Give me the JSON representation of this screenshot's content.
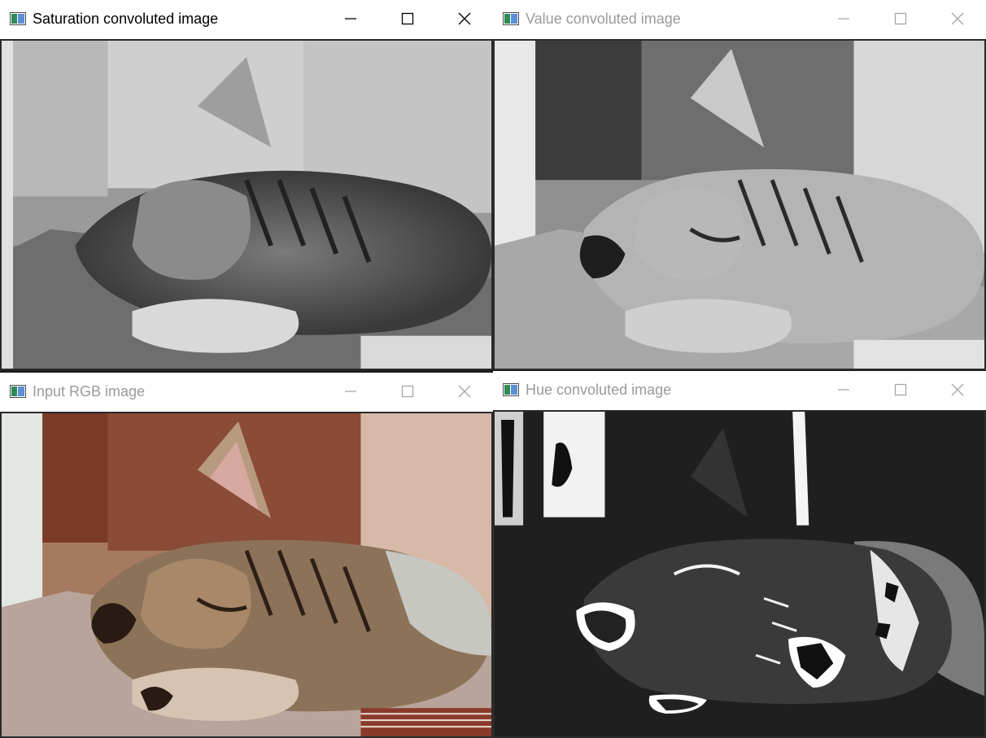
{
  "windows": [
    {
      "id": "saturation",
      "title": "Saturation convoluted image",
      "state": "active"
    },
    {
      "id": "value",
      "title": "Value convoluted image",
      "state": "inactive"
    },
    {
      "id": "input",
      "title": "Input RGB image",
      "state": "inactive"
    },
    {
      "id": "hue",
      "title": "Hue convoluted image",
      "state": "inactive"
    }
  ],
  "controls": {
    "minimize": "minimize-icon",
    "maximize": "maximize-icon",
    "close": "close-icon"
  },
  "images": {
    "saturation": "grayscale kitten, saturation channel",
    "value": "grayscale kitten, value channel",
    "input": "color kitten photograph",
    "hue": "dark kitten with white hue artifacts"
  }
}
